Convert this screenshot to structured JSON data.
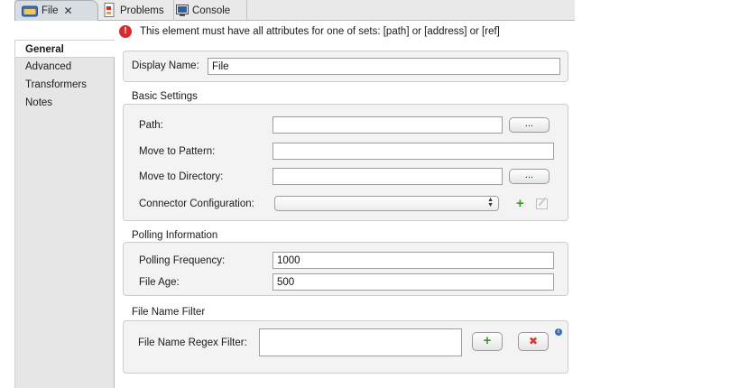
{
  "tabs": [
    {
      "label": "File",
      "close": "✕"
    },
    {
      "label": "Problems"
    },
    {
      "label": "Console"
    }
  ],
  "banner": {
    "message": "This element must have all attributes for one of sets: [path] or [address] or [ref]",
    "icon": "!"
  },
  "nav": {
    "items": [
      {
        "label": "General"
      },
      {
        "label": "Advanced"
      },
      {
        "label": "Transformers"
      },
      {
        "label": "Notes"
      }
    ]
  },
  "general": {
    "display_name_label": "Display Name:",
    "display_name_value": "File"
  },
  "basic": {
    "title": "Basic Settings",
    "path_label": "Path:",
    "path_value": "",
    "move_pattern_label": "Move to Pattern:",
    "move_pattern_value": "",
    "move_dir_label": "Move to Directory:",
    "move_dir_value": "",
    "connector_label": "Connector Configuration:",
    "connector_value": "",
    "browse_label": "..."
  },
  "polling": {
    "title": "Polling Information",
    "frequency_label": "Polling Frequency:",
    "frequency_value": "1000",
    "file_age_label": "File Age:",
    "file_age_value": "500"
  },
  "filter": {
    "title": "File Name Filter",
    "regex_label": "File Name Regex Filter:",
    "regex_value": ""
  },
  "icons": {
    "add": "+",
    "remove": "✖",
    "info": "i"
  },
  "colors": {
    "error": "#d82a2a",
    "add": "#3a9a2a",
    "remove": "#d23a3a",
    "info": "#3d6fb3"
  }
}
